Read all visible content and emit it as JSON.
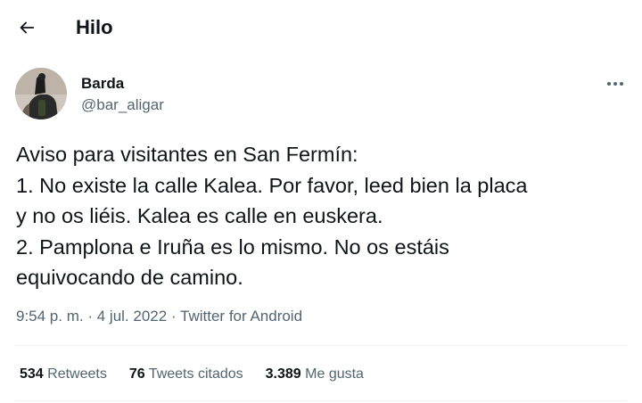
{
  "header": {
    "title": "Hilo",
    "back_icon": "arrow-left-icon"
  },
  "tweet": {
    "author_name": "Barda",
    "author_handle": "@bar_aligar",
    "more_icon": "more-horizontal-icon",
    "text_lines": [
      "Aviso para visitantes en San Fermín:",
      "1. No existe la calle Kalea. Por favor, leed bien la placa",
      "y no os liéis. Kalea es calle en euskera.",
      "2. Pamplona e Iruña es lo mismo. No os estáis",
      "equivocando de camino."
    ],
    "time": "9:54 p. m.",
    "separator": "·",
    "date": "4 jul. 2022",
    "source": "Twitter for Android"
  },
  "stats": {
    "retweets_count": "534",
    "retweets_label": "Retweets",
    "quotes_count": "76",
    "quotes_label": "Tweets citados",
    "likes_count": "3.389",
    "likes_label": "Me gusta"
  },
  "colors": {
    "text_primary": "#0f1419",
    "text_secondary": "#536471",
    "divider": "#eff3f4"
  }
}
